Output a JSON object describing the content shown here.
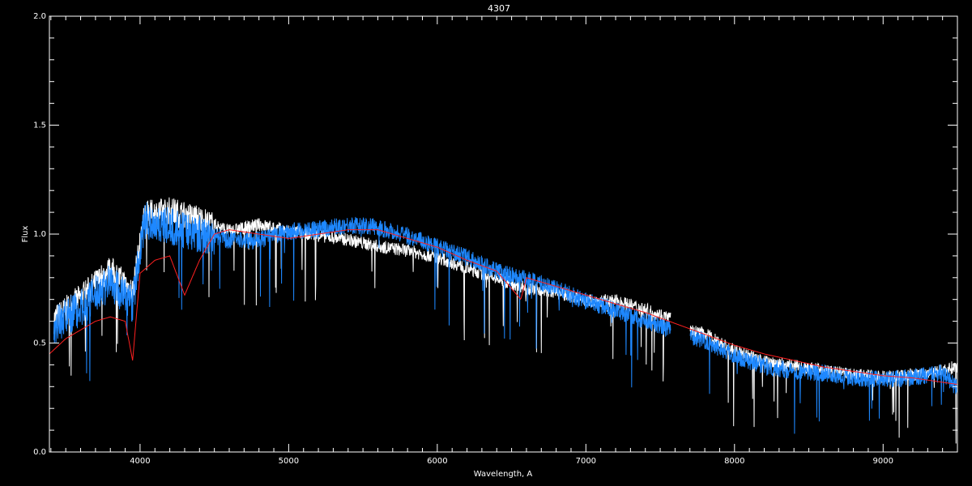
{
  "chart_data": {
    "type": "line",
    "title": "4307",
    "xlabel": "Wavelength, A",
    "ylabel": "Flux",
    "xlim": [
      3390,
      9500
    ],
    "ylim": [
      0.0,
      2.0
    ],
    "x_ticks": [
      4000,
      5000,
      6000,
      7000,
      8000,
      9000
    ],
    "y_ticks": [
      0.0,
      0.5,
      1.0,
      1.5,
      2.0
    ],
    "y_tick_labels": [
      "0.0",
      "0.5",
      "1.0",
      "1.5",
      "2.0"
    ],
    "grid": false,
    "background": "#000000",
    "axis_color": "#ffffff",
    "series": [
      {
        "color": "#ffffff",
        "noise": 0.06,
        "x": [
          3420,
          3600,
          3800,
          3950,
          4030,
          4200,
          4400,
          4600,
          4800,
          5000,
          5200,
          5400,
          5600,
          5800,
          6000,
          6200,
          6400,
          6600,
          6800,
          7000,
          7200,
          7400,
          7570,
          7600,
          7700,
          7800,
          8000,
          8200,
          8400,
          8600,
          8800,
          9000,
          9200,
          9400,
          9500
        ],
        "y": [
          0.62,
          0.72,
          0.85,
          0.75,
          1.1,
          1.12,
          1.08,
          1.02,
          1.05,
          1.02,
          1.0,
          0.98,
          0.95,
          0.93,
          0.9,
          0.85,
          0.8,
          0.76,
          0.74,
          0.7,
          0.7,
          0.66,
          0.62,
          null,
          0.56,
          0.55,
          0.47,
          0.42,
          0.4,
          0.38,
          0.36,
          0.35,
          0.36,
          0.38,
          0.4
        ]
      },
      {
        "color": "#1e88ff",
        "noise": 0.08,
        "x": [
          3420,
          3600,
          3800,
          3950,
          4030,
          4200,
          4400,
          4600,
          4800,
          5000,
          5200,
          5400,
          5600,
          5800,
          6000,
          6200,
          6400,
          6600,
          6800,
          7000,
          7200,
          7400,
          7570,
          7600,
          7700,
          7800,
          8000,
          8200,
          8400,
          8600,
          8800,
          9000,
          9200,
          9400,
          9500
        ],
        "y": [
          0.6,
          0.68,
          0.8,
          0.7,
          1.08,
          1.05,
          1.02,
          0.98,
          0.98,
          1.02,
          1.03,
          1.05,
          1.04,
          1.0,
          0.95,
          0.9,
          0.84,
          0.8,
          0.76,
          0.7,
          0.66,
          0.61,
          0.57,
          null,
          0.54,
          0.52,
          0.45,
          0.4,
          0.38,
          0.37,
          0.35,
          0.34,
          0.35,
          0.37,
          0.3
        ]
      },
      {
        "color": "#ff2020",
        "noise": 0.0,
        "x": [
          3390,
          3500,
          3600,
          3700,
          3800,
          3900,
          3950,
          4000,
          4100,
          4200,
          4300,
          4400,
          4500,
          4600,
          4800,
          5000,
          5200,
          5400,
          5600,
          5800,
          6000,
          6200,
          6400,
          6562,
          6600,
          6800,
          7000,
          7200,
          7400,
          7600,
          7800,
          8000,
          8200,
          8400,
          8600,
          8800,
          9000,
          9200,
          9400,
          9500
        ],
        "y": [
          0.45,
          0.52,
          0.56,
          0.6,
          0.62,
          0.6,
          0.42,
          0.82,
          0.88,
          0.9,
          0.72,
          0.88,
          1.0,
          1.02,
          1.0,
          0.98,
          1.0,
          1.02,
          1.02,
          0.98,
          0.94,
          0.88,
          0.83,
          0.7,
          0.8,
          0.76,
          0.72,
          0.68,
          0.64,
          0.59,
          0.54,
          0.49,
          0.45,
          0.42,
          0.39,
          0.37,
          0.35,
          0.34,
          0.32,
          0.31
        ]
      }
    ]
  }
}
